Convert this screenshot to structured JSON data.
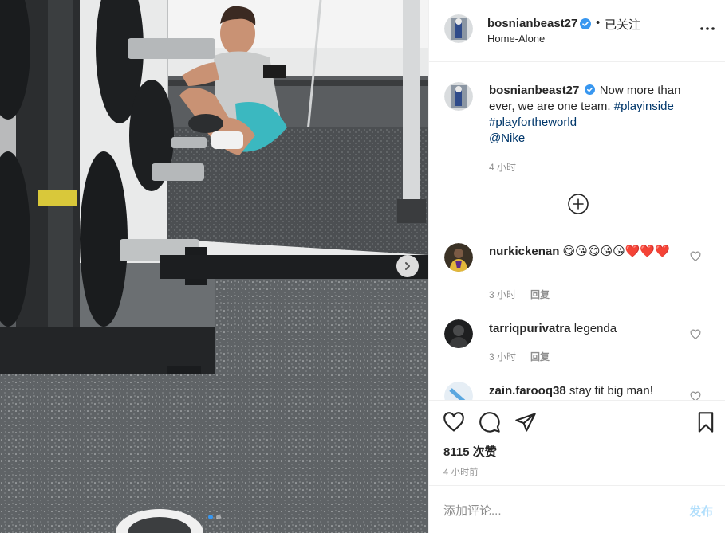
{
  "post": {
    "author": "bosnianbeast27",
    "separator": "•",
    "follow_status": "已关注",
    "location": "Home-Alone",
    "carousel_pages": 2,
    "carousel_current": 1
  },
  "caption": {
    "user": "bosnianbeast27",
    "text": "Now more than ever, we are one team.",
    "hashtag1": "#playinside",
    "hashtag2": "#playfortheworld",
    "mention": "@Nike",
    "time": "4 小时"
  },
  "comments": [
    {
      "user": "nurkickenan",
      "text": "😋😘😋😘😘❤️❤️❤️",
      "time": "3 小时",
      "reply": "回复"
    },
    {
      "user": "tarriqpurivatra",
      "text": "legenda",
      "time": "3 小时",
      "reply": "回复"
    },
    {
      "user": "zain.farooq38",
      "text": "stay fit big man!"
    }
  ],
  "engagement": {
    "likes": "8115 次赞",
    "posted": "4 小时前"
  },
  "composer": {
    "placeholder": "添加评论...",
    "post_label": "发布"
  },
  "colors": {
    "verified": "#3897f0",
    "link": "#00376b",
    "meta": "#8e8e8e",
    "post_button_disabled": "#b2dffc"
  },
  "icons": {
    "more": "more-horizontal-icon",
    "load_more": "plus-circle-icon",
    "like": "heart-icon",
    "comment": "comment-bubble-icon",
    "share": "paper-plane-icon",
    "save": "bookmark-icon",
    "next": "chevron-right-icon"
  }
}
